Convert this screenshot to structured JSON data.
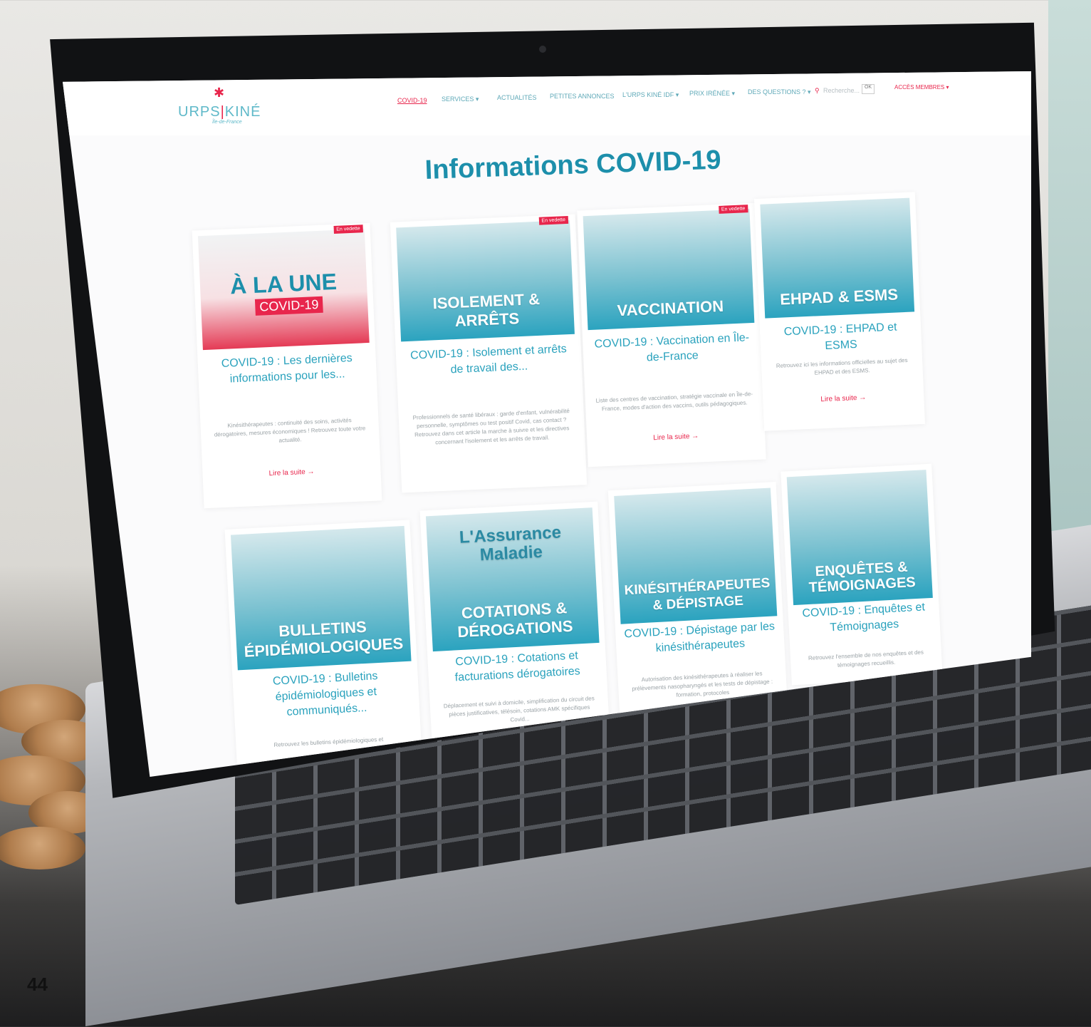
{
  "page_number": "44",
  "colors": {
    "accent_blue": "#1d8fab",
    "accent_red": "#e8264c",
    "card_title_blue": "#2aa2bd"
  },
  "site": {
    "logo_word_left": "URPS",
    "logo_word_right": "KINÉ",
    "logo_sub": "Île-de-France",
    "nav": [
      {
        "label": "COVID-19",
        "active": true
      },
      {
        "label": "SERVICES ▾"
      },
      {
        "label": "ACTUALITÉS"
      },
      {
        "label": "PETITES ANNONCES"
      },
      {
        "label": "L'URPS KINÉ IDF ▾"
      },
      {
        "label": "PRIX IRÉNÉE ▾"
      },
      {
        "label": "DES QUESTIONS ? ▾"
      }
    ],
    "search_placeholder": "Recherche...",
    "search_ok": "OK",
    "members_label": "ACCÈS MEMBRES ▾"
  },
  "page_title": "Informations COVID-19",
  "cards": [
    {
      "badge": "En vedette",
      "img_big": "À LA UNE",
      "img_tag": "COVID-19",
      "title": "COVID-19 : Les dernières informations pour les...",
      "more": "Lire la suite →",
      "excerpt": "Kinésithérapeutes : continuité des soins, activités dérogatoires, mesures économiques ! Retrouvez toute votre actualité."
    },
    {
      "badge": "En vedette",
      "img_text": "ISOLEMENT & ARRÊTS",
      "title": "COVID-19 : Isolement et arrêts de travail des...",
      "more": "",
      "excerpt": "Professionnels de santé libéraux : garde d'enfant, vulnérabilité personnelle, symptômes ou test positif Covid, cas contact ? Retrouvez dans cet article la marche à suivre et les directives concernant l'isolement et les arrêts de travail."
    },
    {
      "badge": "En vedette",
      "img_text": "VACCINATION",
      "title": "COVID-19 : Vaccination en Île-de-France",
      "more": "Lire la suite →",
      "excerpt": "Liste des centres de vaccination, stratégie vaccinale en Île-de-France, modes d'action des vaccins, outils pédagogiques."
    },
    {
      "badge": "",
      "img_text": "EHPAD & ESMS",
      "title": "COVID-19 : EHPAD et ESMS",
      "more": "Lire la suite →",
      "excerpt": "Retrouvez ici les informations officielles au sujet des EHPAD et des ESMS."
    },
    {
      "badge": "",
      "img_text": "BULLETINS ÉPIDÉMIOLOGIQUES",
      "title": "COVID-19 : Bulletins épidémiologiques et communiqués...",
      "more": "",
      "excerpt": "Retrouvez les bulletins épidémiologiques et"
    },
    {
      "badge": "",
      "img_text": "COTATIONS & DÉROGATIONS",
      "img_overlay": "L'Assurance Maladie",
      "title": "COVID-19 : Cotations et facturations dérogatoires",
      "more": "",
      "excerpt": "Déplacement et suivi à domicile, simplification du circuit des pièces justificatives, télésoin, cotations AMK spécifiques Covid..."
    },
    {
      "badge": "",
      "img_text": "KINÉSITHÉRAPEUTES & DÉPISTAGE",
      "title": "COVID-19 : Dépistage par les kinésithérapeutes",
      "more": "",
      "excerpt": "Autorisation des kinésithérapeutes à réaliser les prélèvements nasopharyngés et les tests de dépistage : formation, protocoles"
    },
    {
      "badge": "",
      "img_text": "ENQUÊTES & TÉMOIGNAGES",
      "title": "COVID-19 : Enquêtes et Témoignages",
      "more": "",
      "excerpt": "Retrouvez l'ensemble de nos enquêtes et des témoignages recueillis."
    }
  ]
}
